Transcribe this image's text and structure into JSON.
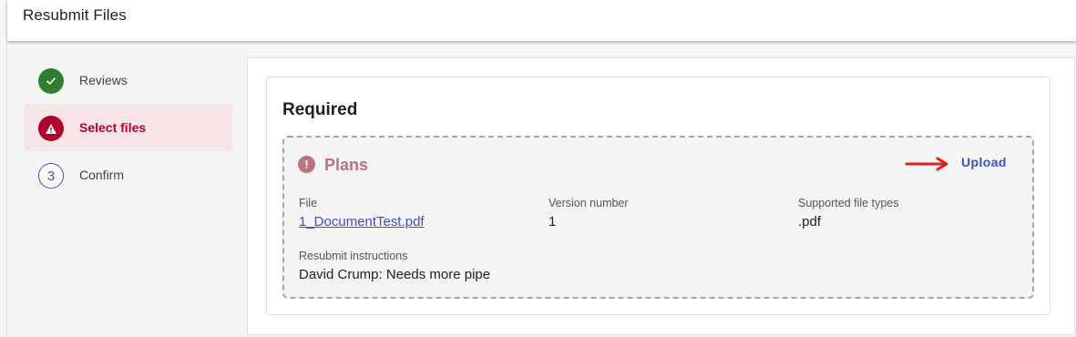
{
  "header": {
    "title": "Resubmit Files"
  },
  "stepper": {
    "steps": [
      {
        "label": "Reviews",
        "state": "done",
        "icon": "check-icon"
      },
      {
        "label": "Select files",
        "state": "error",
        "icon": "warning-icon"
      },
      {
        "label": "Confirm",
        "state": "pending",
        "number": "3"
      }
    ]
  },
  "required": {
    "title": "Required",
    "file_group": {
      "title": "Plans",
      "status_icon": "alert-circle-icon",
      "upload_label": "Upload",
      "file_label": "File",
      "file_name": "1_DocumentTest.pdf",
      "version_label": "Version number",
      "version_value": "1",
      "types_label": "Supported file types",
      "types_value": ".pdf",
      "instructions_label": "Resubmit instructions",
      "instructions_value": "David Crump: Needs more pipe"
    }
  },
  "colors": {
    "accent": "#3f51b5",
    "error": "#b0002e",
    "success": "#2e7d32",
    "plans": "#b9727f",
    "arrow": "#e02020"
  }
}
